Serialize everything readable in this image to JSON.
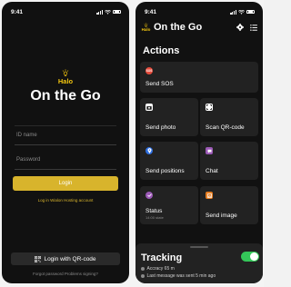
{
  "colors": {
    "accent_gold": "#d8b42c",
    "sos_red": "#e74c3c",
    "blue": "#2f6fe0",
    "purple": "#9b59b6",
    "orange": "#e67e22",
    "green_toggle": "#34c759"
  },
  "login_screen": {
    "status": {
      "time": "9:41"
    },
    "logo_word": "Halo",
    "app_title": "On the Go",
    "id_placeholder": "ID name",
    "password_placeholder": "Password",
    "login_label": "Login",
    "wialon_link": "Log in Wialon Hosting account",
    "qr_login_label": "Login with QR-code",
    "forgot_row": "Forgot password Problems signing?"
  },
  "home_screen": {
    "status": {
      "time": "9:41"
    },
    "logo_word": "Halo",
    "title": "On the Go",
    "icons": {
      "settings": "gear-icon",
      "menu": "list-menu-icon"
    },
    "actions_title": "Actions",
    "actions": {
      "sos": {
        "label": "Send SOS",
        "icon_text": "SOS"
      },
      "photo": {
        "label": "Send photo"
      },
      "qr": {
        "label": "Scan QR-code"
      },
      "positions": {
        "label": "Send positions"
      },
      "chat": {
        "label": "Chat"
      },
      "status": {
        "label": "Status",
        "sub": "14:00 state"
      },
      "image": {
        "label": "Send image"
      }
    },
    "tracking": {
      "title": "Tracking",
      "enabled": true,
      "accuracy": "Accracy 65 m",
      "last_message": "Last message was sent 5 min ago"
    }
  }
}
